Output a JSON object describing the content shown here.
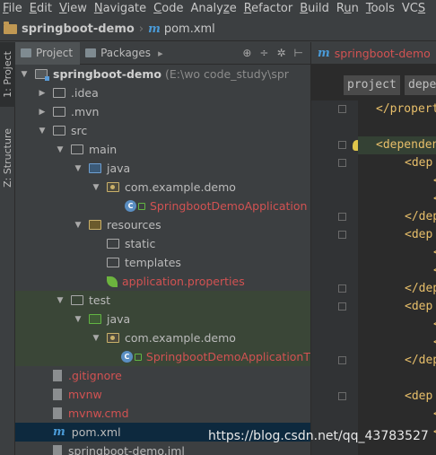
{
  "menu": [
    "File",
    "Edit",
    "View",
    "Navigate",
    "Code",
    "Analyze",
    "Refactor",
    "Build",
    "Run",
    "Tools",
    "VCS"
  ],
  "menu_underline": [
    "F",
    "E",
    "V",
    "N",
    "C",
    "z",
    "R",
    "B",
    "u",
    "T",
    "S"
  ],
  "breadcrumb": {
    "project": "springboot-demo",
    "file": "pom.xml"
  },
  "side_tabs": {
    "project": "1: Project",
    "structure": "Z: Structure"
  },
  "project_panel": {
    "tab_project": "Project",
    "tab_packages": "Packages",
    "tools": [
      "⊕",
      "÷",
      "✲",
      "⊢"
    ]
  },
  "tree": [
    {
      "label": "springboot-demo",
      "hint": "(E:\\wo          code_study\\spr",
      "depth": 0,
      "arrow": "▼",
      "icon": "folder-module",
      "style": "bold"
    },
    {
      "label": ".idea",
      "depth": 1,
      "arrow": "▶",
      "icon": "folder",
      "style": ""
    },
    {
      "label": ".mvn",
      "depth": 1,
      "arrow": "▶",
      "icon": "folder",
      "style": ""
    },
    {
      "label": "src",
      "depth": 1,
      "arrow": "▼",
      "icon": "folder",
      "style": ""
    },
    {
      "label": "main",
      "depth": 2,
      "arrow": "▼",
      "icon": "folder",
      "style": ""
    },
    {
      "label": "java",
      "depth": 3,
      "arrow": "▼",
      "icon": "folder-source",
      "style": ""
    },
    {
      "label": "com.example.demo",
      "depth": 4,
      "arrow": "▼",
      "icon": "package",
      "style": ""
    },
    {
      "label": "SpringbootDemoApplication",
      "depth": 5,
      "arrow": "",
      "icon": "class",
      "style": "red"
    },
    {
      "label": "resources",
      "depth": 3,
      "arrow": "▼",
      "icon": "folder-resources",
      "style": ""
    },
    {
      "label": "static",
      "depth": 4,
      "arrow": "",
      "icon": "folder",
      "style": ""
    },
    {
      "label": "templates",
      "depth": 4,
      "arrow": "",
      "icon": "folder",
      "style": ""
    },
    {
      "label": "application.properties",
      "depth": 4,
      "arrow": "",
      "icon": "spring-properties",
      "style": "red"
    },
    {
      "label": "test",
      "depth": 2,
      "arrow": "▼",
      "icon": "folder",
      "style": ""
    },
    {
      "label": "java",
      "depth": 3,
      "arrow": "▼",
      "icon": "folder-test",
      "style": ""
    },
    {
      "label": "com.example.demo",
      "depth": 4,
      "arrow": "▼",
      "icon": "package",
      "style": ""
    },
    {
      "label": "SpringbootDemoApplicationT",
      "depth": 5,
      "arrow": "",
      "icon": "class",
      "style": "red"
    },
    {
      "label": ".gitignore",
      "depth": 1,
      "arrow": "",
      "icon": "file",
      "style": "red"
    },
    {
      "label": "mvnw",
      "depth": 1,
      "arrow": "",
      "icon": "file",
      "style": "red"
    },
    {
      "label": "mvnw.cmd",
      "depth": 1,
      "arrow": "",
      "icon": "file",
      "style": "red"
    },
    {
      "label": "pom.xml",
      "depth": 1,
      "arrow": "",
      "icon": "maven-file",
      "style": ""
    },
    {
      "label": "springboot-demo.iml",
      "depth": 1,
      "arrow": "",
      "icon": "file",
      "style": ""
    }
  ],
  "editor": {
    "tab": "springboot-demo",
    "crumbs": [
      "project",
      "depe"
    ],
    "code_lines": [
      {
        "text": "</propert",
        "indent": 0
      },
      {
        "text": "",
        "indent": 0
      },
      {
        "text": "<dependen",
        "indent": 0
      },
      {
        "text": "<dep",
        "indent": 1
      },
      {
        "text": "<",
        "indent": 2
      },
      {
        "text": "<",
        "indent": 2
      },
      {
        "text": "</dep",
        "indent": 1
      },
      {
        "text": "<dep",
        "indent": 1
      },
      {
        "text": "<",
        "indent": 2
      },
      {
        "text": "<",
        "indent": 2
      },
      {
        "text": "</dep",
        "indent": 1
      },
      {
        "text": "<dep",
        "indent": 1
      },
      {
        "text": "<",
        "indent": 2
      },
      {
        "text": "<",
        "indent": 2
      },
      {
        "text": "</dep",
        "indent": 1
      },
      {
        "text": "",
        "indent": 0
      },
      {
        "text": "<dep",
        "indent": 1
      },
      {
        "text": "<",
        "indent": 2
      },
      {
        "text": "<",
        "indent": 2
      }
    ]
  },
  "watermark": "https://blog.csdn.net/qq_43783527",
  "colors": {
    "background": "#3c3f41",
    "editor": "#2b2b2b",
    "untracked": "#d25252",
    "selection": "#0d293e",
    "test_bg": "#3a4637",
    "tag": "#e8bf6a"
  }
}
